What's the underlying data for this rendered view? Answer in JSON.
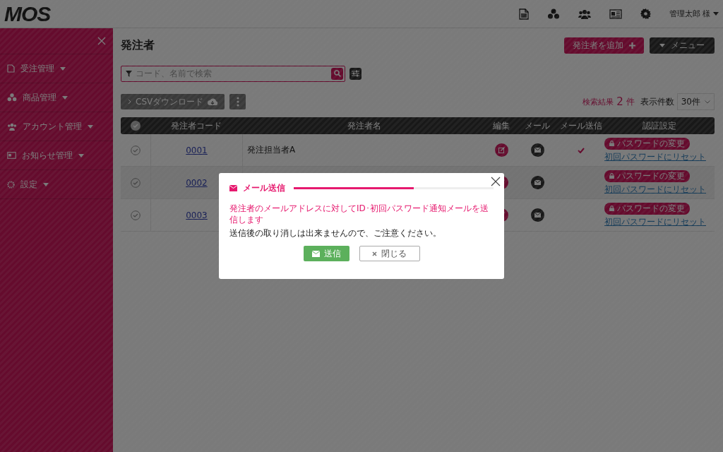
{
  "header": {
    "logo": "MOS",
    "user": "管理太郎 様"
  },
  "sidebar": {
    "items": [
      {
        "label": "受注管理"
      },
      {
        "label": "商品管理"
      },
      {
        "label": "アカウント管理"
      },
      {
        "label": "お知らせ管理"
      },
      {
        "label": "設定"
      }
    ]
  },
  "page": {
    "title": "発注者",
    "add_button": "発注者を追加",
    "menu_button": "メニュー",
    "search": {
      "placeholder": "コード、名前で検索"
    },
    "csv_button": "CSVダウンロード",
    "result_label": "検索結果",
    "result_count": "2",
    "result_unit": "件",
    "per_page_label": "表示件数",
    "per_page": "30件"
  },
  "table": {
    "all_checked": false,
    "columns": [
      "発注者コード",
      "発注者名",
      "編集",
      "メール",
      "メール送信",
      "認証設定"
    ],
    "rows": [
      {
        "checked": false,
        "code": "0001",
        "name": "発注担当者A",
        "mail_sent": true,
        "password_button": "パスワードの変更",
        "reset_link": "初回パスワードにリセット"
      },
      {
        "checked": false,
        "code": "0002",
        "mail_sent": false,
        "password_button": "パスワードの変更",
        "reset_link": "初回パスワードにリセット"
      },
      {
        "checked": false,
        "code": "0003",
        "mail_sent": false,
        "password_button": "パスワードの変更",
        "reset_link": "初回パスワードにリセット"
      }
    ]
  },
  "modal": {
    "title": "メール送信",
    "message": "発注者のメールアドレスに対してID･初回パスワード通知メールを送信します",
    "note": "送信後の取り消しは出来ませんので、ご注意ください。",
    "send_button": "送信",
    "close_button": "閉じる"
  }
}
